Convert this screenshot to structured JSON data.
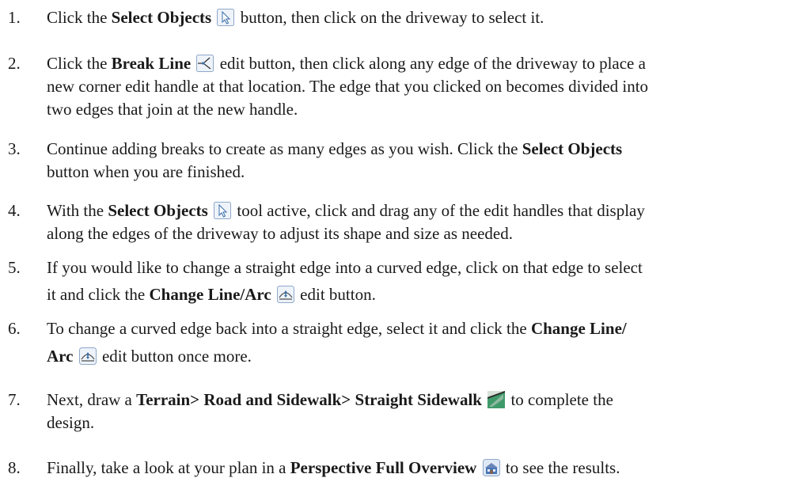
{
  "steps": [
    {
      "number": "1.",
      "parts": {
        "a": "Click the ",
        "b": "Select Objects",
        "c": " button, then click on the driveway to select it."
      },
      "icon": "select-objects-icon"
    },
    {
      "number": "2.",
      "lines": {
        "l1a": "Click the ",
        "l1b": "Break Line",
        "l1c": " edit button, then click along any edge of the driveway to place a",
        "l2": "new corner edit handle at that location. The edge that you clicked on becomes divided into",
        "l3": "two edges that join at the new handle."
      },
      "icon": "break-line-icon"
    },
    {
      "number": "3.",
      "lines": {
        "l1a": "Continue adding breaks to create as many edges as you wish. Click the ",
        "l1b": "Select Objects",
        "l2": "button when you are finished."
      }
    },
    {
      "number": "4.",
      "lines": {
        "l1a": "With the ",
        "l1b": "Select Objects",
        "l1c": " tool active, click and drag any of the edit handles that display",
        "l2": "along the edges of the driveway to adjust its shape and size as needed."
      },
      "icon": "select-objects-icon"
    },
    {
      "number": "5.",
      "lines": {
        "l1": "If you would like to change a straight edge into a curved edge, click on that edge to select",
        "l2a": "it and click the ",
        "l2b": "Change Line/Arc",
        "l2c": " edit button."
      },
      "icon": "change-line-arc-icon"
    },
    {
      "number": "6.",
      "lines": {
        "l1a": "To change a curved edge back into a straight edge, select it and click the ",
        "l1b": "Change Line/",
        "l2a": "Arc",
        "l2b": " edit button once more."
      },
      "icon": "change-line-arc-icon"
    },
    {
      "number": "7.",
      "lines": {
        "l1a": "Next, draw a ",
        "l1b": "Terrain> Road and Sidewalk> Straight Sidewalk",
        "l1c": " to complete the",
        "l2": "design."
      },
      "icon": "straight-sidewalk-icon"
    },
    {
      "number": "8.",
      "lines": {
        "l1a": "Finally, take a look at your plan in a ",
        "l1b": "Perspective Full Overview",
        "l1c": " to see the results."
      },
      "icon": "perspective-full-overview-icon"
    }
  ],
  "colors": {
    "text": "#1a1a1a",
    "icon_border": "#8fa8c8",
    "icon_fill": "#eef3fa",
    "sidewalk_green": "#3f9a6a"
  }
}
